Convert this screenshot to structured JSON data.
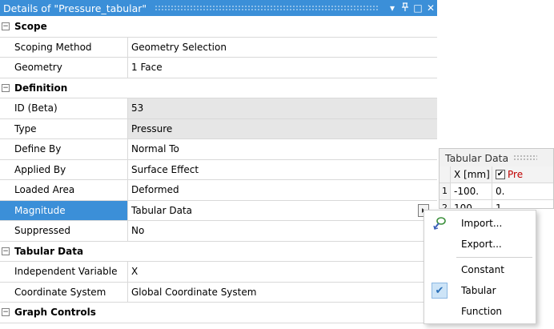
{
  "details": {
    "title": "Details of \"Pressure_tabular\"",
    "controls": {
      "dropdown": "▾",
      "pin": "ᵖ",
      "restore": "□",
      "close": "✕"
    },
    "groups": {
      "scope": "Scope",
      "definition": "Definition",
      "tabular": "Tabular Data",
      "graph": "Graph Controls"
    },
    "rows": {
      "scoping_method": {
        "name": "Scoping Method",
        "value": "Geometry Selection"
      },
      "geometry": {
        "name": "Geometry",
        "value": "1 Face"
      },
      "id": {
        "name": "ID (Beta)",
        "value": "53"
      },
      "type": {
        "name": "Type",
        "value": "Pressure"
      },
      "define_by": {
        "name": "Define By",
        "value": "Normal To"
      },
      "applied_by": {
        "name": "Applied By",
        "value": "Surface Effect"
      },
      "loaded_area": {
        "name": "Loaded Area",
        "value": "Deformed"
      },
      "magnitude": {
        "name": "Magnitude",
        "value": "Tabular Data"
      },
      "suppressed": {
        "name": "Suppressed",
        "value": "No"
      },
      "independent_variable": {
        "name": "Independent Variable",
        "value": "X"
      },
      "coordinate_system": {
        "name": "Coordinate System",
        "value": "Global Coordinate System"
      }
    },
    "expander_glyph": "−"
  },
  "tabular_panel": {
    "title": "Tabular Data",
    "headers": {
      "x": "X [mm]",
      "value": "Pre"
    },
    "rows": [
      {
        "index": "1",
        "x": "-100.",
        "value": "0."
      },
      {
        "index": "2",
        "x": "100.",
        "value": "1"
      }
    ]
  },
  "menu": {
    "items": {
      "import": "Import...",
      "export": "Export...",
      "constant": "Constant",
      "tabular": "Tabular",
      "function": "Function"
    },
    "checked": "tabular"
  },
  "colors": {
    "accent": "#3b8fd8",
    "readonly_bg": "#e6e6e6",
    "pressure_header": "#c00000"
  }
}
